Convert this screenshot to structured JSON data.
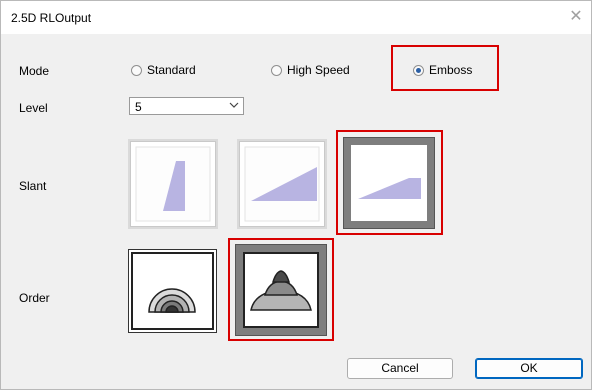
{
  "window": {
    "title": "2.5D RLOutput"
  },
  "mode": {
    "label": "Mode",
    "options": [
      "Standard",
      "High Speed",
      "Emboss"
    ],
    "selected": "Emboss"
  },
  "level": {
    "label": "Level",
    "value": "5"
  },
  "slant": {
    "label": "Slant",
    "selected_index": 2
  },
  "order": {
    "label": "Order",
    "selected_index": 1
  },
  "buttons": {
    "cancel": "Cancel",
    "ok": "OK"
  },
  "colors": {
    "highlight_border": "#d80000",
    "slant_shape": "#b8b4e2",
    "ok_border": "#0067c0"
  }
}
